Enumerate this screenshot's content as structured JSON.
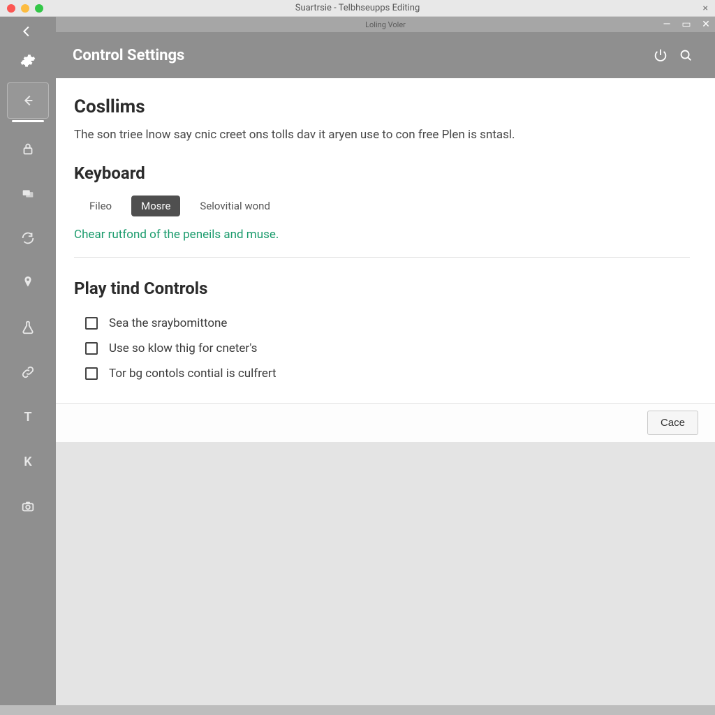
{
  "os": {
    "title": "Suartrsie - Telbhseupps Editing",
    "close_glyph": "×"
  },
  "subwindow": {
    "title": "Loling Voler",
    "min_glyph": "—",
    "max_glyph": "▭",
    "close_glyph": "✕"
  },
  "sidebar": {
    "items": [
      {
        "name": "back-arrow",
        "kind": "icon"
      },
      {
        "name": "lock",
        "kind": "icon"
      },
      {
        "name": "cards",
        "kind": "icon"
      },
      {
        "name": "refresh",
        "kind": "icon"
      },
      {
        "name": "pin",
        "kind": "icon"
      },
      {
        "name": "flask",
        "kind": "icon"
      },
      {
        "name": "link",
        "kind": "icon"
      },
      {
        "name": "letter-t",
        "kind": "letter",
        "glyph": "T"
      },
      {
        "name": "letter-k",
        "kind": "letter",
        "glyph": "K"
      },
      {
        "name": "camera",
        "kind": "icon"
      }
    ]
  },
  "header": {
    "title": "Control Settings"
  },
  "page": {
    "section1_title": "Cosllims",
    "section1_desc": "The son triee lnow say cnic creet ons tolls dav it aryen use to con free Plen is sntasl.",
    "keyboard_title": "Keyboard",
    "tabs": [
      {
        "label": "Fileo",
        "active": false
      },
      {
        "label": "Mosre",
        "active": true
      },
      {
        "label": "Selovitial wond",
        "active": false
      }
    ],
    "hint": "Chear rutfond of the peneils and muse.",
    "controls_title": "Play tind Controls",
    "checks": [
      {
        "label": "Sea the sraybomittone",
        "checked": false
      },
      {
        "label": "Use so klow thig for cneter's",
        "checked": false
      },
      {
        "label": "Tor bg contols contial is culfrert",
        "checked": false
      }
    ]
  },
  "footer": {
    "cancel_label": "Cace"
  }
}
